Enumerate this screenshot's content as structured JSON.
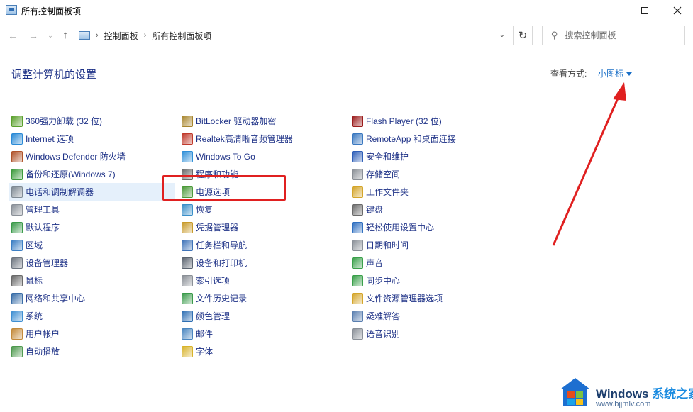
{
  "window": {
    "title": "所有控制面板项"
  },
  "nav": {
    "back_glyph": "←",
    "forward_glyph": "→",
    "history_glyph": "⌄",
    "up_glyph": "↑",
    "refresh_glyph": "↻"
  },
  "address": {
    "sep1": "›",
    "crumb1": "控制面板",
    "sep2": "›",
    "crumb2": "所有控制面板项",
    "dropdown_glyph": "⌄"
  },
  "search": {
    "placeholder": "搜索控制面板",
    "icon": "search-icon"
  },
  "header": {
    "title": "调整计算机的设置",
    "view_by_label": "查看方式:",
    "view_mode": "小图标"
  },
  "columns": [
    {
      "items": [
        {
          "label": "360强力卸载 (32 位)",
          "icon": "uninstall-icon",
          "color": "#5aa02c"
        },
        {
          "label": "Internet 选项",
          "icon": "internet-options-icon",
          "color": "#2a8ad6"
        },
        {
          "label": "Windows Defender 防火墙",
          "icon": "firewall-icon",
          "color": "#b0532a"
        },
        {
          "label": "备份和还原(Windows 7)",
          "icon": "backup-icon",
          "color": "#3c9a3c"
        },
        {
          "label": "电话和调制解调器",
          "icon": "phone-modem-icon",
          "color": "#7f8a94"
        },
        {
          "label": "管理工具",
          "icon": "admin-tools-icon",
          "color": "#8a9098"
        },
        {
          "label": "默认程序",
          "icon": "default-programs-icon",
          "color": "#3a9a4a"
        },
        {
          "label": "区域",
          "icon": "region-icon",
          "color": "#3c7fc4"
        },
        {
          "label": "设备管理器",
          "icon": "device-manager-icon",
          "color": "#6e7680"
        },
        {
          "label": "鼠标",
          "icon": "mouse-icon",
          "color": "#6a6a6a"
        },
        {
          "label": "网络和共享中心",
          "icon": "network-icon",
          "color": "#3a6ea8"
        },
        {
          "label": "系统",
          "icon": "system-icon",
          "color": "#3f8fd2"
        },
        {
          "label": "用户帐户",
          "icon": "user-accounts-icon",
          "color": "#c48a3a"
        },
        {
          "label": "自动播放",
          "icon": "autoplay-icon",
          "color": "#4f9a4f"
        }
      ]
    },
    {
      "items": [
        {
          "label": "BitLocker 驱动器加密",
          "icon": "bitlocker-icon",
          "color": "#a8862e"
        },
        {
          "label": "Realtek高清晰音频管理器",
          "icon": "realtek-icon",
          "color": "#c0392b"
        },
        {
          "label": "Windows To Go",
          "icon": "windows-to-go-icon",
          "color": "#2f8fd8"
        },
        {
          "label": "程序和功能",
          "icon": "programs-features-icon",
          "color": "#6a6a6a"
        },
        {
          "label": "电源选项",
          "icon": "power-options-icon",
          "color": "#4c9a3a"
        },
        {
          "label": "恢复",
          "icon": "recovery-icon",
          "color": "#3a8fc9"
        },
        {
          "label": "凭据管理器",
          "icon": "credential-icon",
          "color": "#c89a2a"
        },
        {
          "label": "任务栏和导航",
          "icon": "taskbar-icon",
          "color": "#3f73b8"
        },
        {
          "label": "设备和打印机",
          "icon": "printer-icon",
          "color": "#5b6470"
        },
        {
          "label": "索引选项",
          "icon": "indexing-icon",
          "color": "#8a8f96"
        },
        {
          "label": "文件历史记录",
          "icon": "file-history-icon",
          "color": "#3a9a4a"
        },
        {
          "label": "颜色管理",
          "icon": "color-management-icon",
          "color": "#2f6fb3"
        },
        {
          "label": "邮件",
          "icon": "mail-icon",
          "color": "#4a86c0"
        },
        {
          "label": "字体",
          "icon": "fonts-icon",
          "color": "#d8b32a"
        }
      ]
    },
    {
      "items": [
        {
          "label": "Flash Player (32 位)",
          "icon": "flash-player-icon",
          "color": "#9b1c1c"
        },
        {
          "label": "RemoteApp 和桌面连接",
          "icon": "remoteapp-icon",
          "color": "#3a78c0"
        },
        {
          "label": "安全和维护",
          "icon": "security-flag-icon",
          "color": "#2f5fb8"
        },
        {
          "label": "存储空间",
          "icon": "storage-icon",
          "color": "#8a8f96"
        },
        {
          "label": "工作文件夹",
          "icon": "work-folders-icon",
          "color": "#d4a52a"
        },
        {
          "label": "键盘",
          "icon": "keyboard-icon",
          "color": "#6a6a6a"
        },
        {
          "label": "轻松使用设置中心",
          "icon": "ease-of-access-icon",
          "color": "#2f6fc0"
        },
        {
          "label": "日期和时间",
          "icon": "date-time-icon",
          "color": "#8a9098"
        },
        {
          "label": "声音",
          "icon": "sound-icon",
          "color": "#3aa04a"
        },
        {
          "label": "同步中心",
          "icon": "sync-center-icon",
          "color": "#3aa04a"
        },
        {
          "label": "文件资源管理器选项",
          "icon": "explorer-options-icon",
          "color": "#d4a52a"
        },
        {
          "label": "疑难解答",
          "icon": "troubleshoot-icon",
          "color": "#5a7fb0"
        },
        {
          "label": "语音识别",
          "icon": "speech-icon",
          "color": "#8a9098"
        }
      ]
    }
  ],
  "highlighted_item": "电话和调制解调器",
  "annotation_color": "#e02020",
  "watermark": {
    "title_en": "Windows ",
    "title_cn": "系统之家",
    "url": "www.bjjmlv.com"
  }
}
